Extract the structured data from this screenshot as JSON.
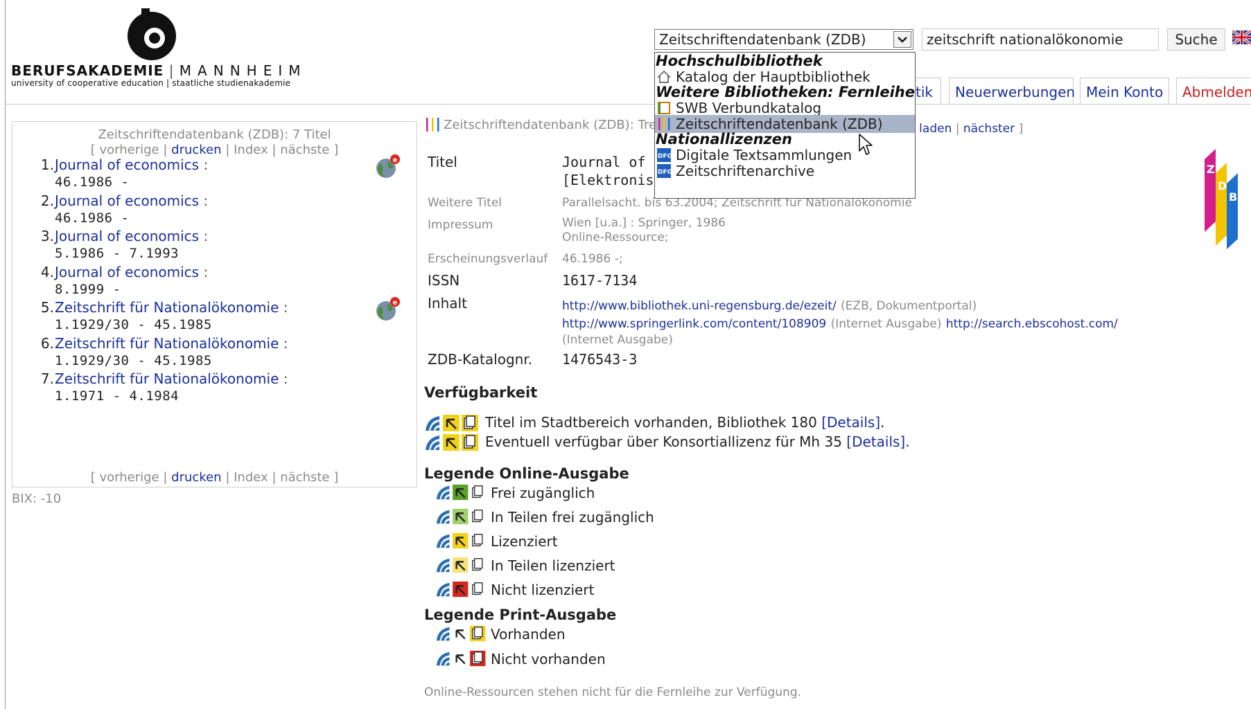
{
  "logo": {
    "name_bold": "BERUFSAKADEMIE",
    "name_thin": "MANNHEIM",
    "subtitle": "university of cooperative education | staatliche studienakademie"
  },
  "search": {
    "selected_catalog": "Zeitschriftendatenbank (ZDB)",
    "query": "zeitschrift nationalökonomie",
    "button": "Suche"
  },
  "dropdown": {
    "groups": [
      {
        "label": "Hochschulbibliothek",
        "items": [
          {
            "label": "Katalog der Hauptbibliothek",
            "icon": "house-icon"
          }
        ]
      },
      {
        "label": "Weitere Bibliotheken: Fernleihe",
        "items": [
          {
            "label": "SWB Verbundkatalog",
            "icon": "swb-icon"
          },
          {
            "label": "Zeitschriftendatenbank (ZDB)",
            "icon": "zdb-icon",
            "selected": true
          }
        ]
      },
      {
        "label": "Nationallizenzen",
        "items": [
          {
            "label": "Digitale Textsammlungen",
            "icon": "dfg-icon"
          },
          {
            "label": "Zeitschriftenarchive",
            "icon": "dfg-icon"
          }
        ]
      }
    ]
  },
  "nav": {
    "tabs": [
      "tik",
      "Neuerwerbungen",
      "Mein Konto",
      "Abmelden"
    ]
  },
  "results": {
    "header": "Zeitschriftendatenbank (ZDB): 7 Titel",
    "pager": {
      "prev": "vorherige",
      "print": "drucken",
      "index": "Index",
      "next": "nächste",
      "open": "[",
      "close": "]",
      "sep": "|"
    },
    "items": [
      {
        "num": "1.",
        "title": "Journal of economics",
        "holdings": "46.1986 -",
        "online": true
      },
      {
        "num": "2.",
        "title": "Journal of economics",
        "holdings": "46.1986 -",
        "online": false
      },
      {
        "num": "3.",
        "title": "Journal of economics",
        "holdings": "5.1986 - 7.1993",
        "online": false
      },
      {
        "num": "4.",
        "title": "Journal of economics",
        "holdings": "8.1999 -",
        "online": false
      },
      {
        "num": "5.",
        "title": "Zeitschrift für Nationalökonomie",
        "holdings": "1.1929/30 - 45.1985",
        "online": true
      },
      {
        "num": "6.",
        "title": "Zeitschrift für Nationalökonomie",
        "holdings": "1.1929/30 - 45.1985",
        "online": false
      },
      {
        "num": "7.",
        "title": "Zeitschrift für Nationalökonomie",
        "holdings": "1.1971 - 4.1984",
        "online": false
      }
    ],
    "colon": ":",
    "bix": "BIX: -10"
  },
  "detail": {
    "breadcrumb": "Zeitschriftendatenbank (ZDB): Tre",
    "nav_reload": "u laden",
    "nav_next": "nächster",
    "fields": {
      "titel_label": "Titel",
      "titel_value_1": "Journal of ec",
      "titel_value_2": "[Elektronisch",
      "weitere_label": "Weitere Titel",
      "weitere_value": "Parallelsacht. bis 63.2004; Zeitschrift für Nationalökonomie",
      "impressum_label": "Impressum",
      "impressum_value_1": "Wien [u.a.] : Springer, 1986",
      "impressum_value_2": "Online-Ressource;",
      "verlauf_label": "Erscheinungsverlauf",
      "verlauf_value": "46.1986 -;",
      "issn_label": "ISSN",
      "issn_value": "1617-7134",
      "inhalt_label": "Inhalt",
      "url_1": "http://www.bibliothek.uni-regensburg.de/ezeit/",
      "url_1_note": "(EZB, Dokumentportal)",
      "url_2": "http://www.springerlink.com/content/108909",
      "url_2_note": "(Internet Ausgabe)",
      "url_3": "http://search.ebscohost.com/",
      "url_3_note": "(Internet Ausgabe)",
      "katalog_label": "ZDB-Katalognr.",
      "katalog_value": "1476543-3"
    },
    "availability_heading": "Verfügbarkeit",
    "availability": [
      {
        "text": "Titel im Stadtbereich vorhanden, Bibliothek 180",
        "link": "[Details]",
        "end": "."
      },
      {
        "text": "Eventuell verfügbar über Konsortiallizenz für Mh 35",
        "link": "[Details]",
        "end": "."
      }
    ],
    "legend_online_heading": "Legende Online-Ausgabe",
    "legend_online": [
      "Frei zugänglich",
      "In Teilen frei zugänglich",
      "Lizenziert",
      "In Teilen lizenziert",
      "Nicht lizenziert"
    ],
    "legend_print_heading": "Legende Print-Ausgabe",
    "legend_print": [
      "Vorhanden",
      "Nicht vorhanden"
    ],
    "footnote": "Online-Ressourcen stehen nicht für die Fernleihe zur Verfügung."
  },
  "colors": {
    "link": "#1a2f9c",
    "logout": "#c62020",
    "green": "#5aa02c",
    "yellow": "#f2d21a",
    "red": "#d9261c",
    "selected_row": "#a9b4c8"
  }
}
